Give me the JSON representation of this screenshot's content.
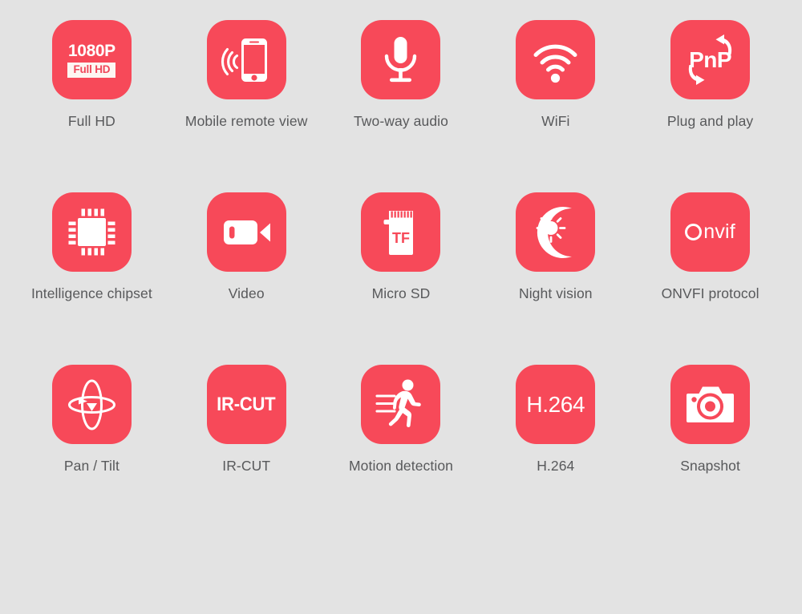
{
  "page": {
    "background_color": "#e3e3e3",
    "tile_color": "#f74959",
    "label_color": "#58595b",
    "icon_color": "#ffffff"
  },
  "features": [
    {
      "label": "Full HD",
      "icon": "full-hd-icon",
      "badge_top": "1080P",
      "badge_bottom": "Full HD"
    },
    {
      "label": "Mobile remote view",
      "icon": "mobile-phone-signal-icon"
    },
    {
      "label": "Two-way audio",
      "icon": "microphone-icon"
    },
    {
      "label": "WiFi",
      "icon": "wifi-icon"
    },
    {
      "label": "Plug and play",
      "icon": "plug-and-play-icon",
      "badge_top": "PnP"
    },
    {
      "label": "Intelligence chipset",
      "icon": "chipset-icon"
    },
    {
      "label": "Video",
      "icon": "video-camera-icon"
    },
    {
      "label": "Micro SD",
      "icon": "micro-sd-card-icon",
      "badge_top": "TF"
    },
    {
      "label": "Night vision",
      "icon": "moon-sun-icon"
    },
    {
      "label": "ONVFI protocol",
      "icon": "onvif-logo-icon",
      "badge_top": "O",
      "badge_bottom": "nvif"
    },
    {
      "label": "Pan / Tilt",
      "icon": "pan-tilt-rotation-icon"
    },
    {
      "label": "IR-CUT",
      "icon": "ir-cut-icon",
      "badge_top": "IR-CUT"
    },
    {
      "label": "Motion detection",
      "icon": "running-person-icon"
    },
    {
      "label": "H.264",
      "icon": "h264-icon",
      "badge_top": "H.264"
    },
    {
      "label": "Snapshot",
      "icon": "camera-icon"
    }
  ]
}
